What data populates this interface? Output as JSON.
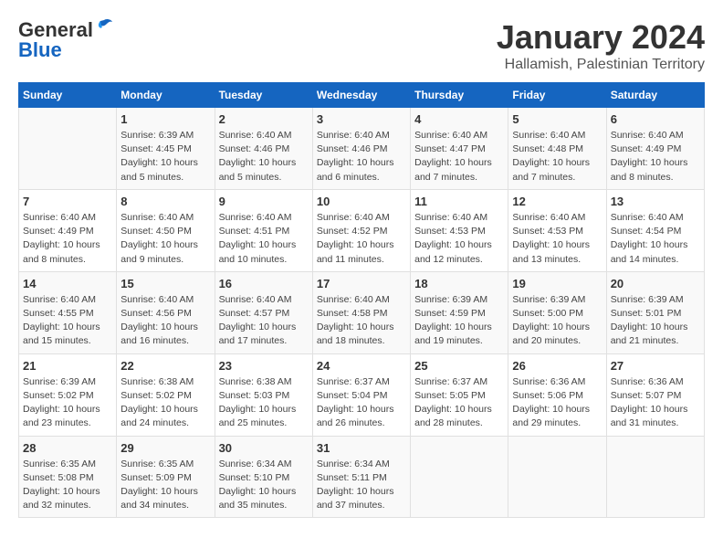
{
  "header": {
    "logo_general": "General",
    "logo_blue": "Blue",
    "month_title": "January 2024",
    "location": "Hallamish, Palestinian Territory"
  },
  "days_of_week": [
    "Sunday",
    "Monday",
    "Tuesday",
    "Wednesday",
    "Thursday",
    "Friday",
    "Saturday"
  ],
  "weeks": [
    [
      {
        "day": "",
        "info": ""
      },
      {
        "day": "1",
        "info": "Sunrise: 6:39 AM\nSunset: 4:45 PM\nDaylight: 10 hours\nand 5 minutes."
      },
      {
        "day": "2",
        "info": "Sunrise: 6:40 AM\nSunset: 4:46 PM\nDaylight: 10 hours\nand 5 minutes."
      },
      {
        "day": "3",
        "info": "Sunrise: 6:40 AM\nSunset: 4:46 PM\nDaylight: 10 hours\nand 6 minutes."
      },
      {
        "day": "4",
        "info": "Sunrise: 6:40 AM\nSunset: 4:47 PM\nDaylight: 10 hours\nand 7 minutes."
      },
      {
        "day": "5",
        "info": "Sunrise: 6:40 AM\nSunset: 4:48 PM\nDaylight: 10 hours\nand 7 minutes."
      },
      {
        "day": "6",
        "info": "Sunrise: 6:40 AM\nSunset: 4:49 PM\nDaylight: 10 hours\nand 8 minutes."
      }
    ],
    [
      {
        "day": "7",
        "info": "Sunrise: 6:40 AM\nSunset: 4:49 PM\nDaylight: 10 hours\nand 8 minutes."
      },
      {
        "day": "8",
        "info": "Sunrise: 6:40 AM\nSunset: 4:50 PM\nDaylight: 10 hours\nand 9 minutes."
      },
      {
        "day": "9",
        "info": "Sunrise: 6:40 AM\nSunset: 4:51 PM\nDaylight: 10 hours\nand 10 minutes."
      },
      {
        "day": "10",
        "info": "Sunrise: 6:40 AM\nSunset: 4:52 PM\nDaylight: 10 hours\nand 11 minutes."
      },
      {
        "day": "11",
        "info": "Sunrise: 6:40 AM\nSunset: 4:53 PM\nDaylight: 10 hours\nand 12 minutes."
      },
      {
        "day": "12",
        "info": "Sunrise: 6:40 AM\nSunset: 4:53 PM\nDaylight: 10 hours\nand 13 minutes."
      },
      {
        "day": "13",
        "info": "Sunrise: 6:40 AM\nSunset: 4:54 PM\nDaylight: 10 hours\nand 14 minutes."
      }
    ],
    [
      {
        "day": "14",
        "info": "Sunrise: 6:40 AM\nSunset: 4:55 PM\nDaylight: 10 hours\nand 15 minutes."
      },
      {
        "day": "15",
        "info": "Sunrise: 6:40 AM\nSunset: 4:56 PM\nDaylight: 10 hours\nand 16 minutes."
      },
      {
        "day": "16",
        "info": "Sunrise: 6:40 AM\nSunset: 4:57 PM\nDaylight: 10 hours\nand 17 minutes."
      },
      {
        "day": "17",
        "info": "Sunrise: 6:40 AM\nSunset: 4:58 PM\nDaylight: 10 hours\nand 18 minutes."
      },
      {
        "day": "18",
        "info": "Sunrise: 6:39 AM\nSunset: 4:59 PM\nDaylight: 10 hours\nand 19 minutes."
      },
      {
        "day": "19",
        "info": "Sunrise: 6:39 AM\nSunset: 5:00 PM\nDaylight: 10 hours\nand 20 minutes."
      },
      {
        "day": "20",
        "info": "Sunrise: 6:39 AM\nSunset: 5:01 PM\nDaylight: 10 hours\nand 21 minutes."
      }
    ],
    [
      {
        "day": "21",
        "info": "Sunrise: 6:39 AM\nSunset: 5:02 PM\nDaylight: 10 hours\nand 23 minutes."
      },
      {
        "day": "22",
        "info": "Sunrise: 6:38 AM\nSunset: 5:02 PM\nDaylight: 10 hours\nand 24 minutes."
      },
      {
        "day": "23",
        "info": "Sunrise: 6:38 AM\nSunset: 5:03 PM\nDaylight: 10 hours\nand 25 minutes."
      },
      {
        "day": "24",
        "info": "Sunrise: 6:37 AM\nSunset: 5:04 PM\nDaylight: 10 hours\nand 26 minutes."
      },
      {
        "day": "25",
        "info": "Sunrise: 6:37 AM\nSunset: 5:05 PM\nDaylight: 10 hours\nand 28 minutes."
      },
      {
        "day": "26",
        "info": "Sunrise: 6:36 AM\nSunset: 5:06 PM\nDaylight: 10 hours\nand 29 minutes."
      },
      {
        "day": "27",
        "info": "Sunrise: 6:36 AM\nSunset: 5:07 PM\nDaylight: 10 hours\nand 31 minutes."
      }
    ],
    [
      {
        "day": "28",
        "info": "Sunrise: 6:35 AM\nSunset: 5:08 PM\nDaylight: 10 hours\nand 32 minutes."
      },
      {
        "day": "29",
        "info": "Sunrise: 6:35 AM\nSunset: 5:09 PM\nDaylight: 10 hours\nand 34 minutes."
      },
      {
        "day": "30",
        "info": "Sunrise: 6:34 AM\nSunset: 5:10 PM\nDaylight: 10 hours\nand 35 minutes."
      },
      {
        "day": "31",
        "info": "Sunrise: 6:34 AM\nSunset: 5:11 PM\nDaylight: 10 hours\nand 37 minutes."
      },
      {
        "day": "",
        "info": ""
      },
      {
        "day": "",
        "info": ""
      },
      {
        "day": "",
        "info": ""
      }
    ]
  ]
}
